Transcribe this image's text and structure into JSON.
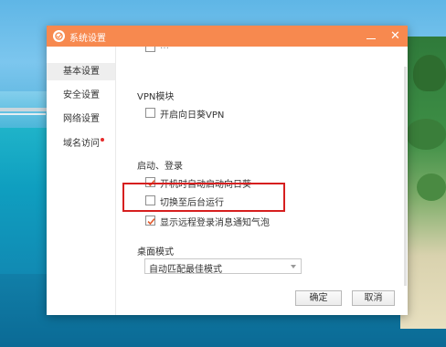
{
  "window": {
    "title": "系统设置",
    "minimize_icon": "minimize-icon",
    "close_glyph": "✕"
  },
  "sidebar": {
    "items": [
      {
        "label": "基本设置",
        "active": true
      },
      {
        "label": "安全设置",
        "active": false
      },
      {
        "label": "网络设置",
        "active": false
      },
      {
        "label": "域名访问",
        "active": false,
        "badge": "red-dot"
      }
    ]
  },
  "content": {
    "top_partial": {
      "label": "…",
      "checked": false
    },
    "vpn": {
      "title": "VPN模块",
      "options": [
        {
          "label": "开启向日葵VPN",
          "checked": false
        }
      ]
    },
    "startup": {
      "title": "启动、登录",
      "options": [
        {
          "label": "开机时自动启动向日葵",
          "checked": true
        },
        {
          "label": "切换至后台运行",
          "checked": false
        },
        {
          "label": "显示远程登录消息通知气泡",
          "checked": true,
          "highlighted": true
        }
      ]
    },
    "desktop_mode": {
      "title": "桌面模式",
      "selected": "自动匹配最佳模式"
    }
  },
  "footer": {
    "ok_label": "确定",
    "cancel_label": "取消"
  },
  "colors": {
    "titlebar": "#f7894f",
    "checkmark": "#e2572a",
    "highlight_border": "#d61f1f",
    "badge": "#e62c2c"
  }
}
